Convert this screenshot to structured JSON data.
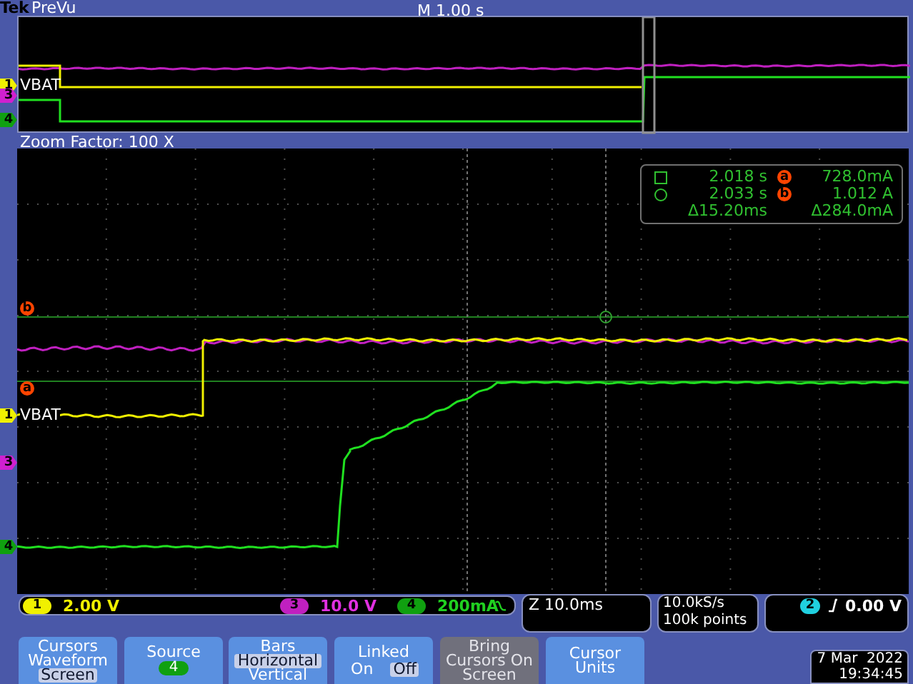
{
  "header": {
    "brand": "Tek",
    "mode": "PreVu",
    "timebase": "M 1.00 s"
  },
  "overview": {
    "trace_label": "VBAT",
    "markers": [
      {
        "label": "1",
        "color": "#f0f000"
      },
      {
        "label": "3",
        "color": "#d020d0"
      },
      {
        "label": "4",
        "color": "#10a010"
      }
    ]
  },
  "zoom": {
    "title": "Zoom Factor: 100 X",
    "trace_label": "VBAT",
    "markers": [
      {
        "label": "1",
        "color": "#f0f000"
      },
      {
        "label": "3",
        "color": "#d020d0"
      },
      {
        "label": "4",
        "color": "#10a010"
      }
    ],
    "cursors": [
      {
        "label": "b"
      },
      {
        "label": "a"
      }
    ]
  },
  "cursor_readout": {
    "rows": [
      {
        "kind": "square",
        "time": "2.018 s",
        "cursor": "a",
        "value": "728.0mA"
      },
      {
        "kind": "circle",
        "time": "2.033 s",
        "cursor": "b",
        "value": "1.012 A"
      },
      {
        "kind": "delta",
        "time": "Δ15.20ms",
        "value": "Δ284.0mA"
      }
    ]
  },
  "channels": [
    {
      "label": "1",
      "scale": "2.00 V",
      "color": "#f0f000"
    },
    {
      "label": "3",
      "scale": "10.0 V",
      "color": "#c020c0"
    },
    {
      "label": "4",
      "scale": "200mA",
      "color": "#10a010"
    }
  ],
  "horizontal": "Z 10.0ms",
  "acquisition": [
    "10.0kS/s",
    "100k points"
  ],
  "trigger": {
    "source": "2",
    "level": "0.00 V"
  },
  "menu": [
    {
      "kind": "options",
      "title": "Cursors",
      "options": [
        {
          "label": "Waveform",
          "selected": false
        },
        {
          "label": "Screen",
          "selected": true
        }
      ]
    },
    {
      "kind": "value",
      "title": "Source",
      "value": "4"
    },
    {
      "kind": "options",
      "title": "Bars",
      "options": [
        {
          "label": "Horizontal",
          "selected": true
        },
        {
          "label": "Vertical",
          "selected": false
        }
      ]
    },
    {
      "kind": "toggle",
      "title": "Linked",
      "options": [
        {
          "label": "On",
          "selected": false
        },
        {
          "label": "Off",
          "selected": true
        }
      ]
    },
    {
      "kind": "action",
      "label": "Bring Cursors On Screen",
      "disabled": true
    },
    {
      "kind": "action",
      "label": "Cursor Units",
      "disabled": false
    }
  ],
  "datetime": [
    "7 Mar  2022",
    "19:34:45"
  ]
}
